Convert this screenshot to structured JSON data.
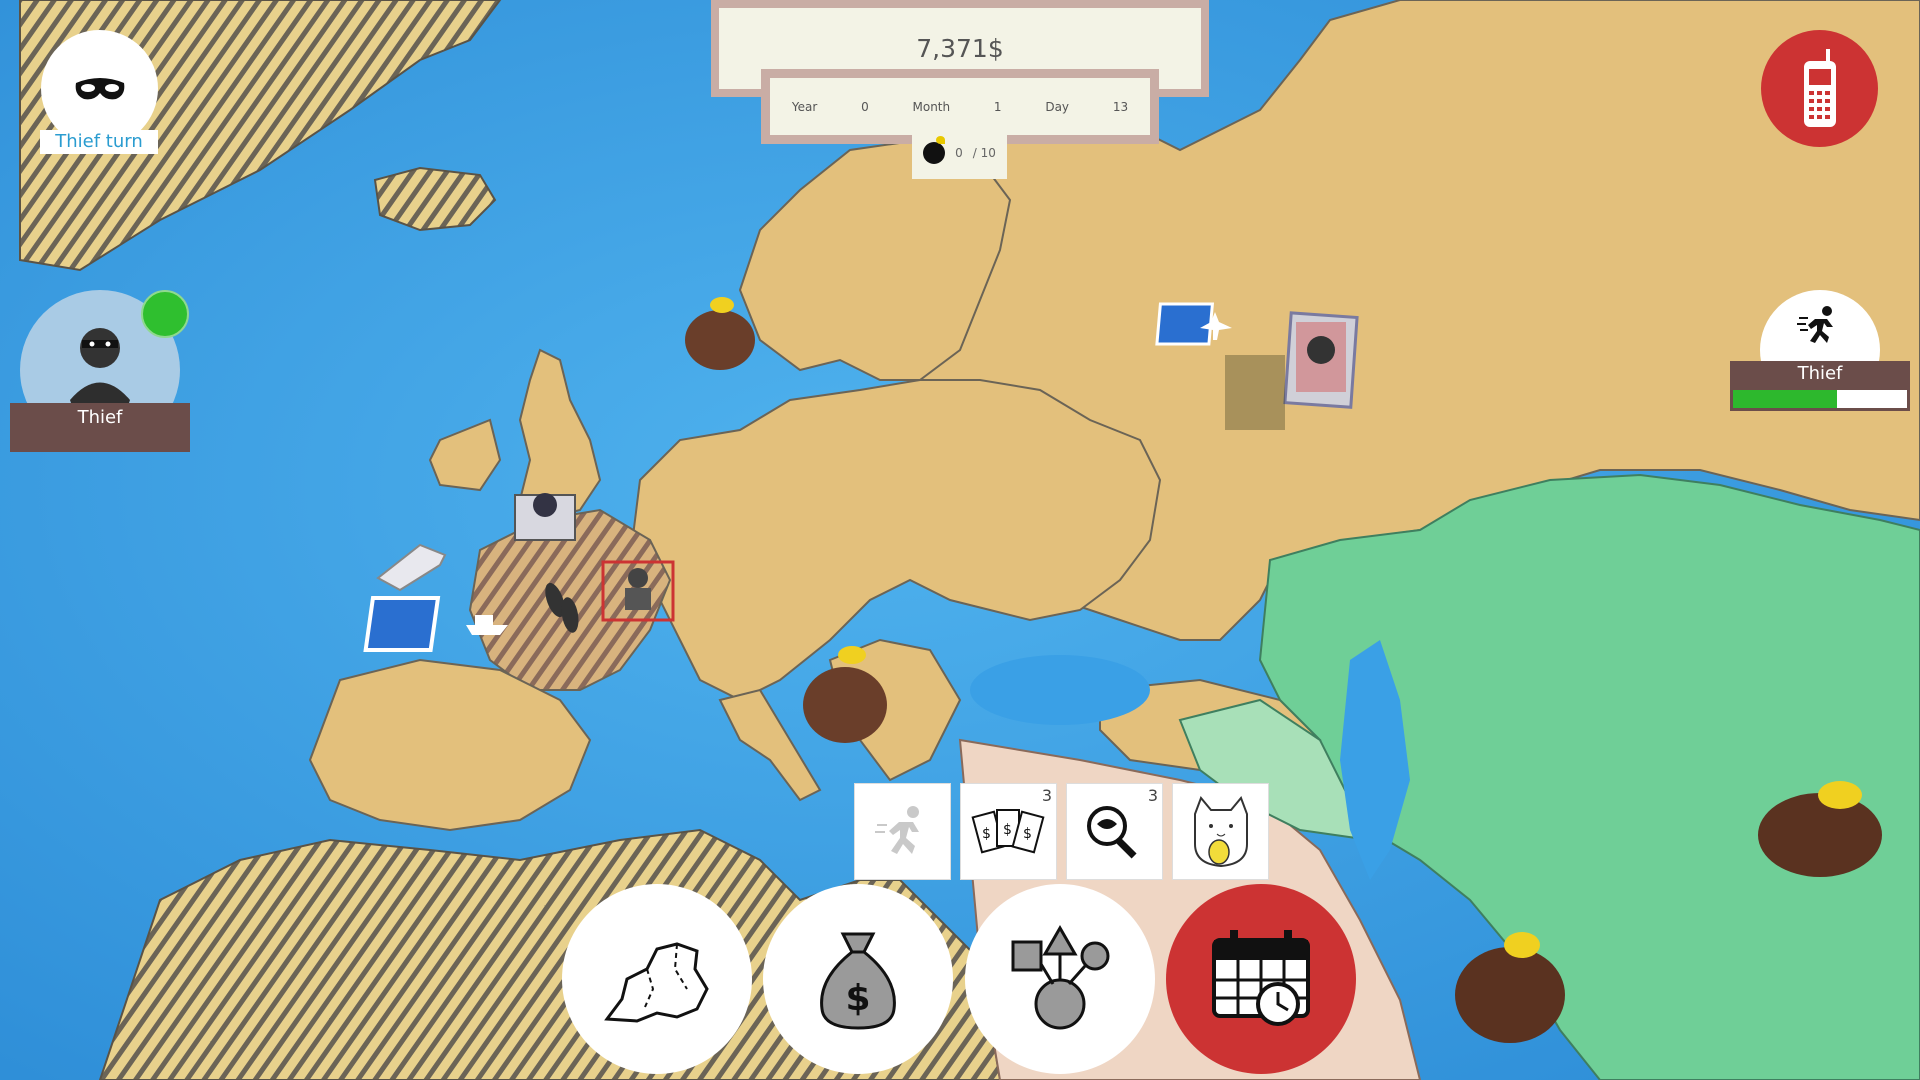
{
  "hud": {
    "money": "7,371$",
    "date": {
      "year_label": "Year",
      "year_value": "0",
      "month_label": "Month",
      "month_value": "1",
      "day_label": "Day",
      "day_value": "13"
    },
    "loot": {
      "collected": "0",
      "total": "/ 10",
      "icon": "bomb-icon"
    }
  },
  "turn": {
    "label": "Thief turn",
    "icon": "mask-icon"
  },
  "player": {
    "name": "Thief",
    "status_color": "#2fbf2f"
  },
  "phone": {
    "icon": "phone-icon",
    "color": "#cc3333"
  },
  "thief_status": {
    "label": "Thief",
    "progress": 0.6,
    "icon": "running-icon"
  },
  "ability_cards": [
    {
      "name": "sprint",
      "icon": "running-icon",
      "count": ""
    },
    {
      "name": "money-cards",
      "icon": "dollar-cards-icon",
      "count": "3"
    },
    {
      "name": "search",
      "icon": "magnifier-icon",
      "count": "3"
    },
    {
      "name": "lucky-cat",
      "icon": "lucky-cat-icon",
      "count": ""
    }
  ],
  "actions": [
    {
      "name": "map",
      "icon": "map-icon"
    },
    {
      "name": "money",
      "icon": "money-bag-icon"
    },
    {
      "name": "skills",
      "icon": "shapes-icon"
    },
    {
      "name": "calendar",
      "icon": "calendar-clock-icon",
      "color": "#cc3333"
    }
  ],
  "colors": {
    "sea": "#3d9fe0",
    "land": "#e3c07c",
    "asia_green": "#6fcf97",
    "hud_border": "#c9ada5"
  }
}
